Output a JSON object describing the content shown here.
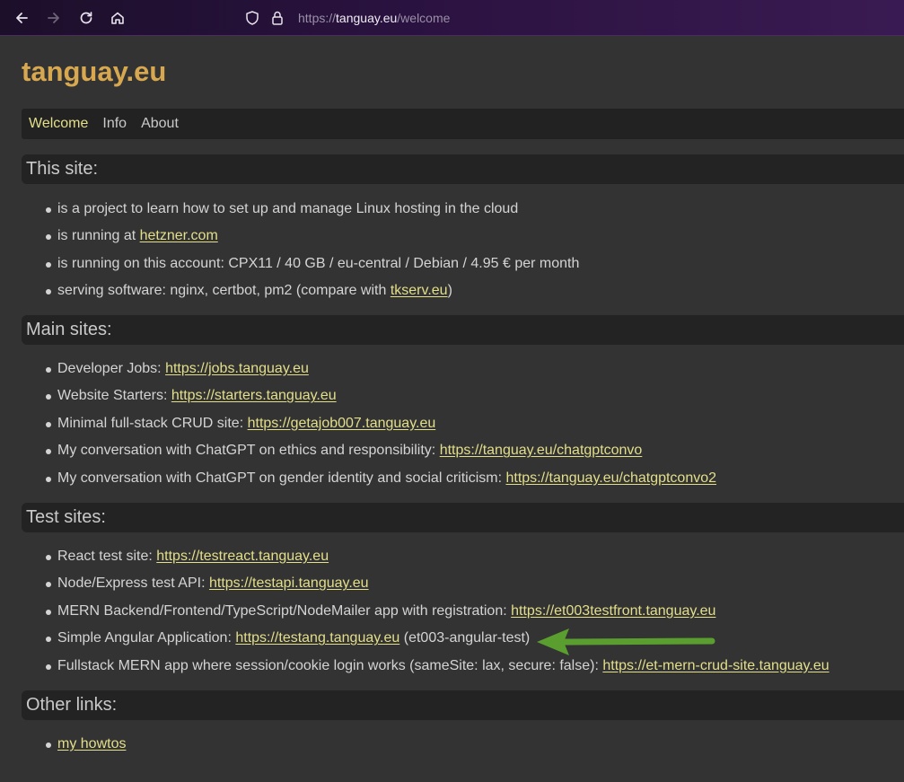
{
  "browser": {
    "url_scheme": "https://",
    "url_host": "tanguay.eu",
    "url_path": "/welcome"
  },
  "site": {
    "title": "tanguay.eu"
  },
  "menu": {
    "items": [
      "Welcome",
      "Info",
      "About"
    ],
    "active": "Welcome"
  },
  "sections": {
    "this_site": {
      "heading": "This site:",
      "items": [
        {
          "text": "is a project to learn how to set up and manage Linux hosting in the cloud"
        },
        {
          "text": "is running at ",
          "link": "hetzner.com"
        },
        {
          "text": "is running on this account: CPX11 / 40 GB / eu-central / Debian / 4.95 € per month"
        },
        {
          "text": "serving software: nginx, certbot, pm2 (compare with ",
          "link": "tkserv.eu",
          "after": ")"
        }
      ]
    },
    "main_sites": {
      "heading": "Main sites:",
      "items": [
        {
          "text": "Developer Jobs: ",
          "link": "https://jobs.tanguay.eu"
        },
        {
          "text": "Website Starters: ",
          "link": "https://starters.tanguay.eu"
        },
        {
          "text": "Minimal full-stack CRUD site: ",
          "link": "https://getajob007.tanguay.eu"
        },
        {
          "text": "My conversation with ChatGPT on ethics and responsibility: ",
          "link": "https://tanguay.eu/chatgptconvo"
        },
        {
          "text": "My conversation with ChatGPT on gender identity and social criticism: ",
          "link": "https://tanguay.eu/chatgptconvo2"
        }
      ]
    },
    "test_sites": {
      "heading": "Test sites:",
      "items": [
        {
          "text": "React test site: ",
          "link": "https://testreact.tanguay.eu"
        },
        {
          "text": "Node/Express test API: ",
          "link": "https://testapi.tanguay.eu"
        },
        {
          "text": "MERN Backend/Frontend/TypeScript/NodeMailer app with registration: ",
          "link": "https://et003testfront.tanguay.eu"
        },
        {
          "text": "Simple Angular Application: ",
          "link": "https://testang.tanguay.eu",
          "after": " (et003-angular-test)"
        },
        {
          "text": "Fullstack MERN app where session/cookie login works (sameSite: lax, secure: false): ",
          "link": "https://et-mern-crud-site.tanguay.eu"
        }
      ]
    },
    "other_links": {
      "heading": "Other links:",
      "items": [
        {
          "text": "",
          "link": "my howtos"
        }
      ]
    }
  },
  "colors": {
    "title": "#d7a84f",
    "link": "#e3df8a",
    "arrow": "#5a9e2f",
    "background": "#333333",
    "header_bar": "#232323"
  },
  "icons": [
    "back-icon",
    "forward-icon",
    "reload-icon",
    "home-icon",
    "shield-icon",
    "lock-icon",
    "green-arrow-icon"
  ]
}
